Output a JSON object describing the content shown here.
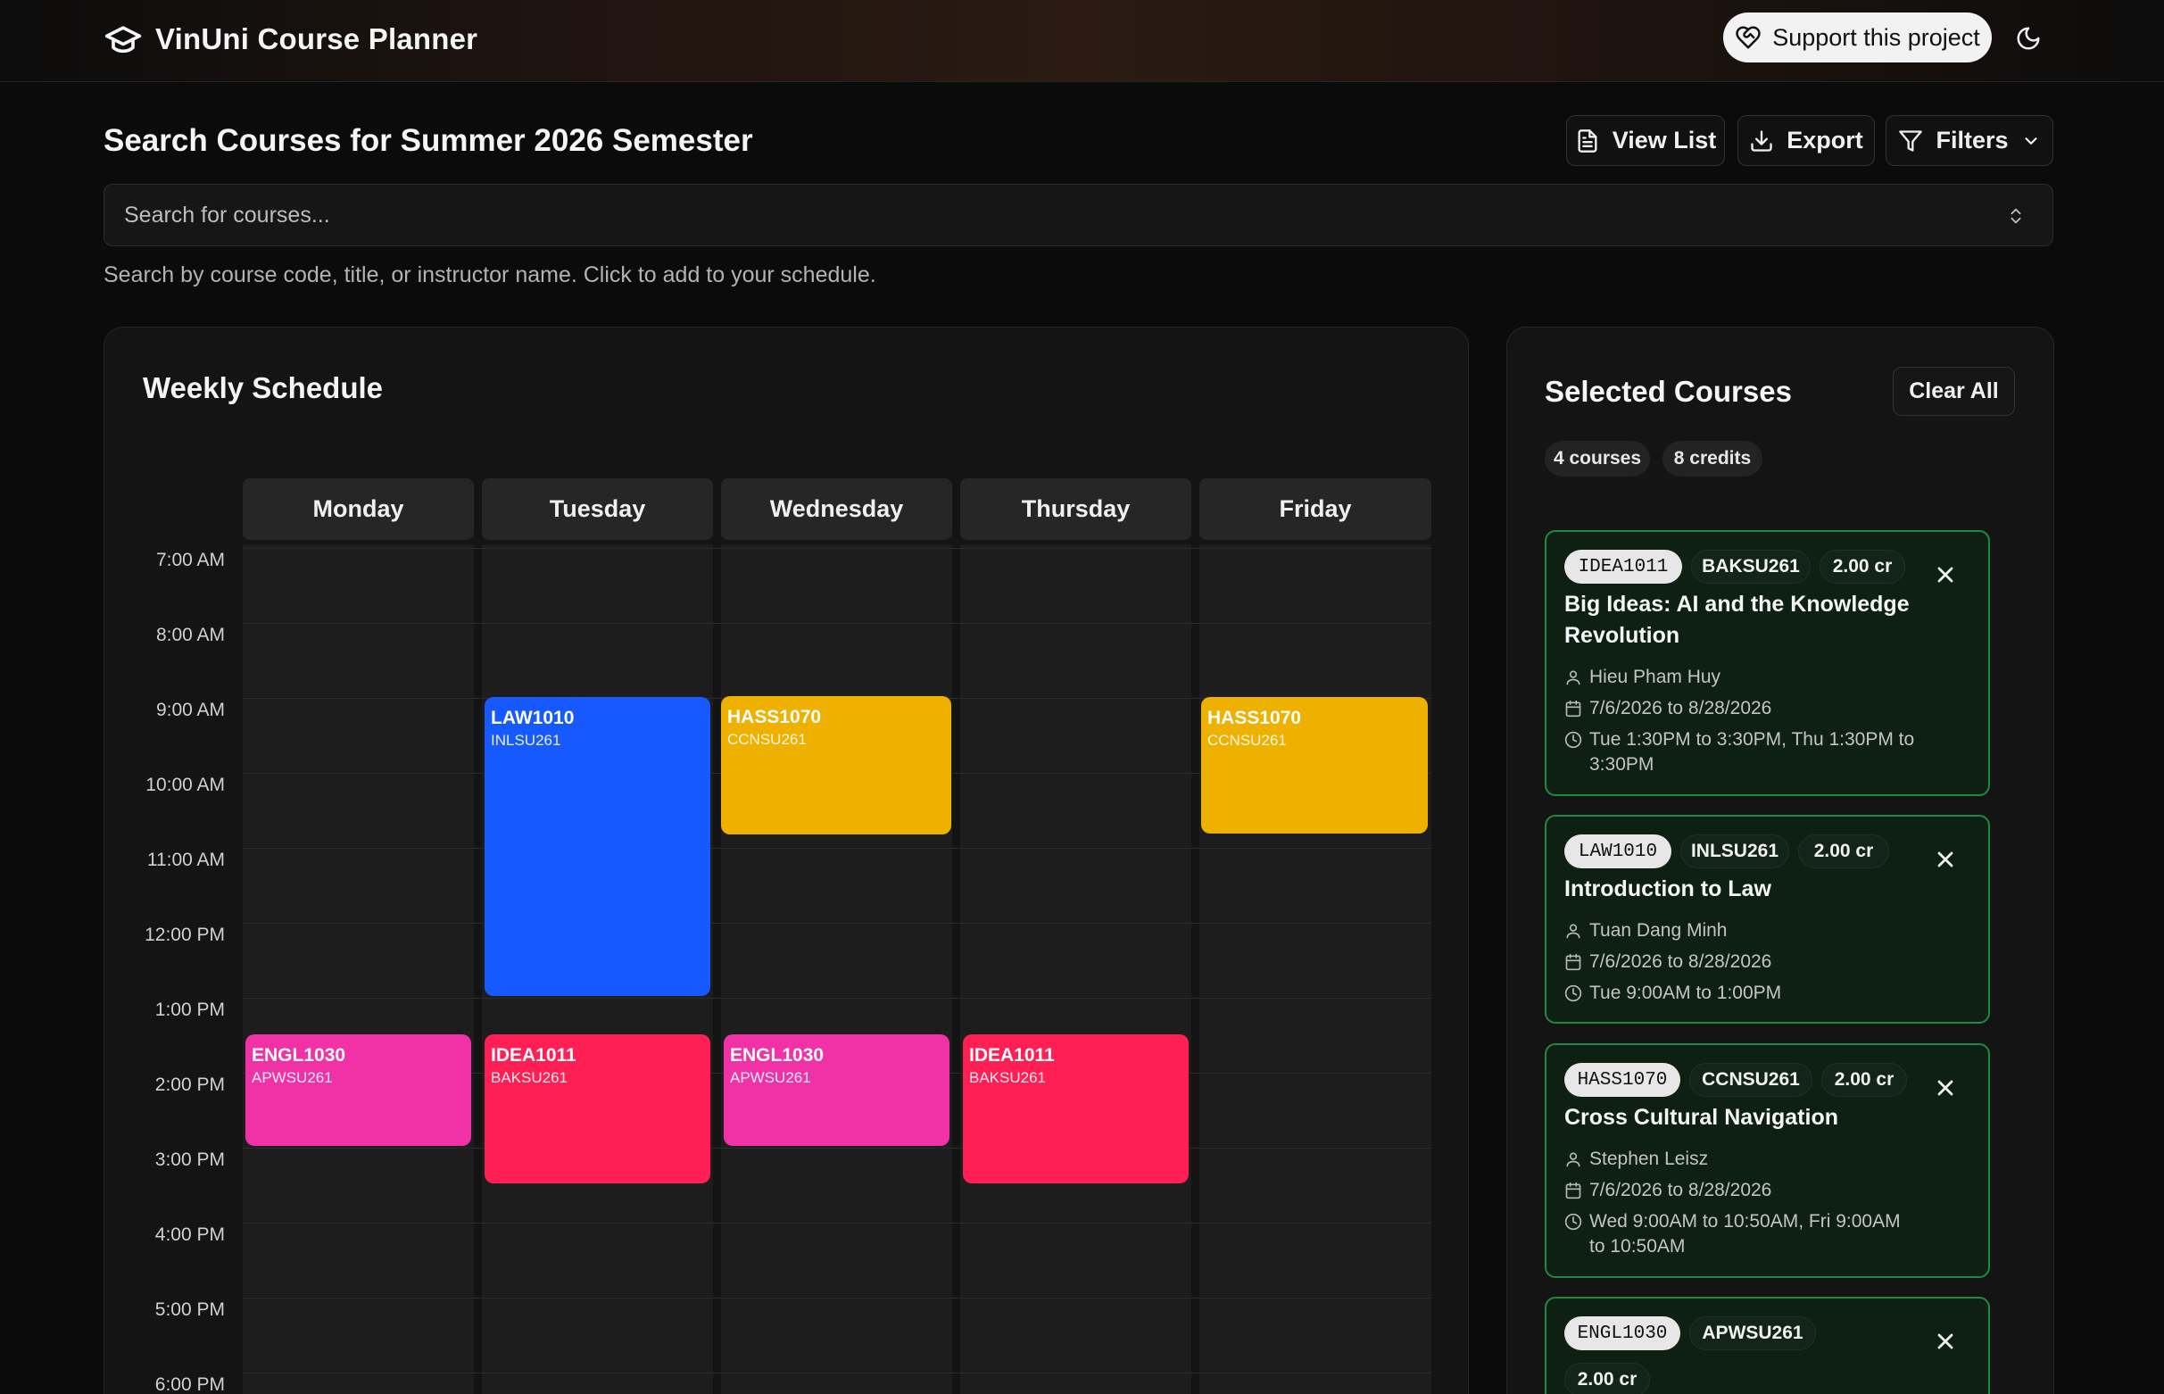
{
  "header": {
    "title": "VinUni Course Planner",
    "support_label": "Support this project"
  },
  "search": {
    "heading": "Search Courses for Summer 2026 Semester",
    "view_list_label": "View List",
    "export_label": "Export",
    "filters_label": "Filters",
    "placeholder": "Search for courses...",
    "helper": "Search by course code, title, or instructor name. Click to add to your schedule."
  },
  "schedule": {
    "title": "Weekly Schedule",
    "days": [
      "Monday",
      "Tuesday",
      "Wednesday",
      "Thursday",
      "Friday"
    ],
    "times": [
      "7:00 AM",
      "8:00 AM",
      "9:00 AM",
      "10:00 AM",
      "11:00 AM",
      "12:00 PM",
      "1:00 PM",
      "2:00 PM",
      "3:00 PM",
      "4:00 PM",
      "5:00 PM",
      "6:00 PM"
    ],
    "events": [
      {
        "code": "LAW1010",
        "section": "INLSU261",
        "color": "#1559ff"
      },
      {
        "code": "HASS1070",
        "section": "CCNSU261",
        "color": "#efb100"
      },
      {
        "code": "HASS1070",
        "section": "CCNSU261",
        "color": "#efb100"
      },
      {
        "code": "ENGL1030",
        "section": "APWSU261",
        "color": "#f032a6"
      },
      {
        "code": "IDEA1011",
        "section": "BAKSU261",
        "color": "#ff1f55"
      },
      {
        "code": "ENGL1030",
        "section": "APWSU261",
        "color": "#f032a6"
      },
      {
        "code": "IDEA1011",
        "section": "BAKSU261",
        "color": "#ff1f55"
      }
    ]
  },
  "selected": {
    "title": "Selected Courses",
    "clear_label": "Clear All",
    "count_label": "4 courses",
    "credits_label": "8 credits",
    "courses": [
      {
        "code": "IDEA1011",
        "section": "BAKSU261",
        "credits": "2.00 cr",
        "title_line1": "Big Ideas: AI and the Knowledge",
        "title_line2": "Revolution",
        "instructor": "Hieu Pham Huy",
        "dates": "7/6/2026 to 8/28/2026",
        "time_line1": "Tue 1:30PM to 3:30PM, Thu 1:30PM to",
        "time_line2": "3:30PM"
      },
      {
        "code": "LAW1010",
        "section": "INLSU261",
        "credits": "2.00 cr",
        "title_line1": "Introduction to Law",
        "instructor": "Tuan Dang Minh",
        "dates": "7/6/2026 to 8/28/2026",
        "time_line1": "Tue 9:00AM to 1:00PM"
      },
      {
        "code": "HASS1070",
        "section": "CCNSU261",
        "credits": "2.00 cr",
        "title_line1": "Cross Cultural Navigation",
        "instructor": "Stephen Leisz",
        "dates": "7/6/2026 to 8/28/2026",
        "time_line1": "Wed 9:00AM to 10:50AM, Fri 9:00AM",
        "time_line2": "to 10:50AM"
      },
      {
        "code": "ENGL1030",
        "section": "APWSU261",
        "credits": "2.00 cr"
      }
    ]
  }
}
